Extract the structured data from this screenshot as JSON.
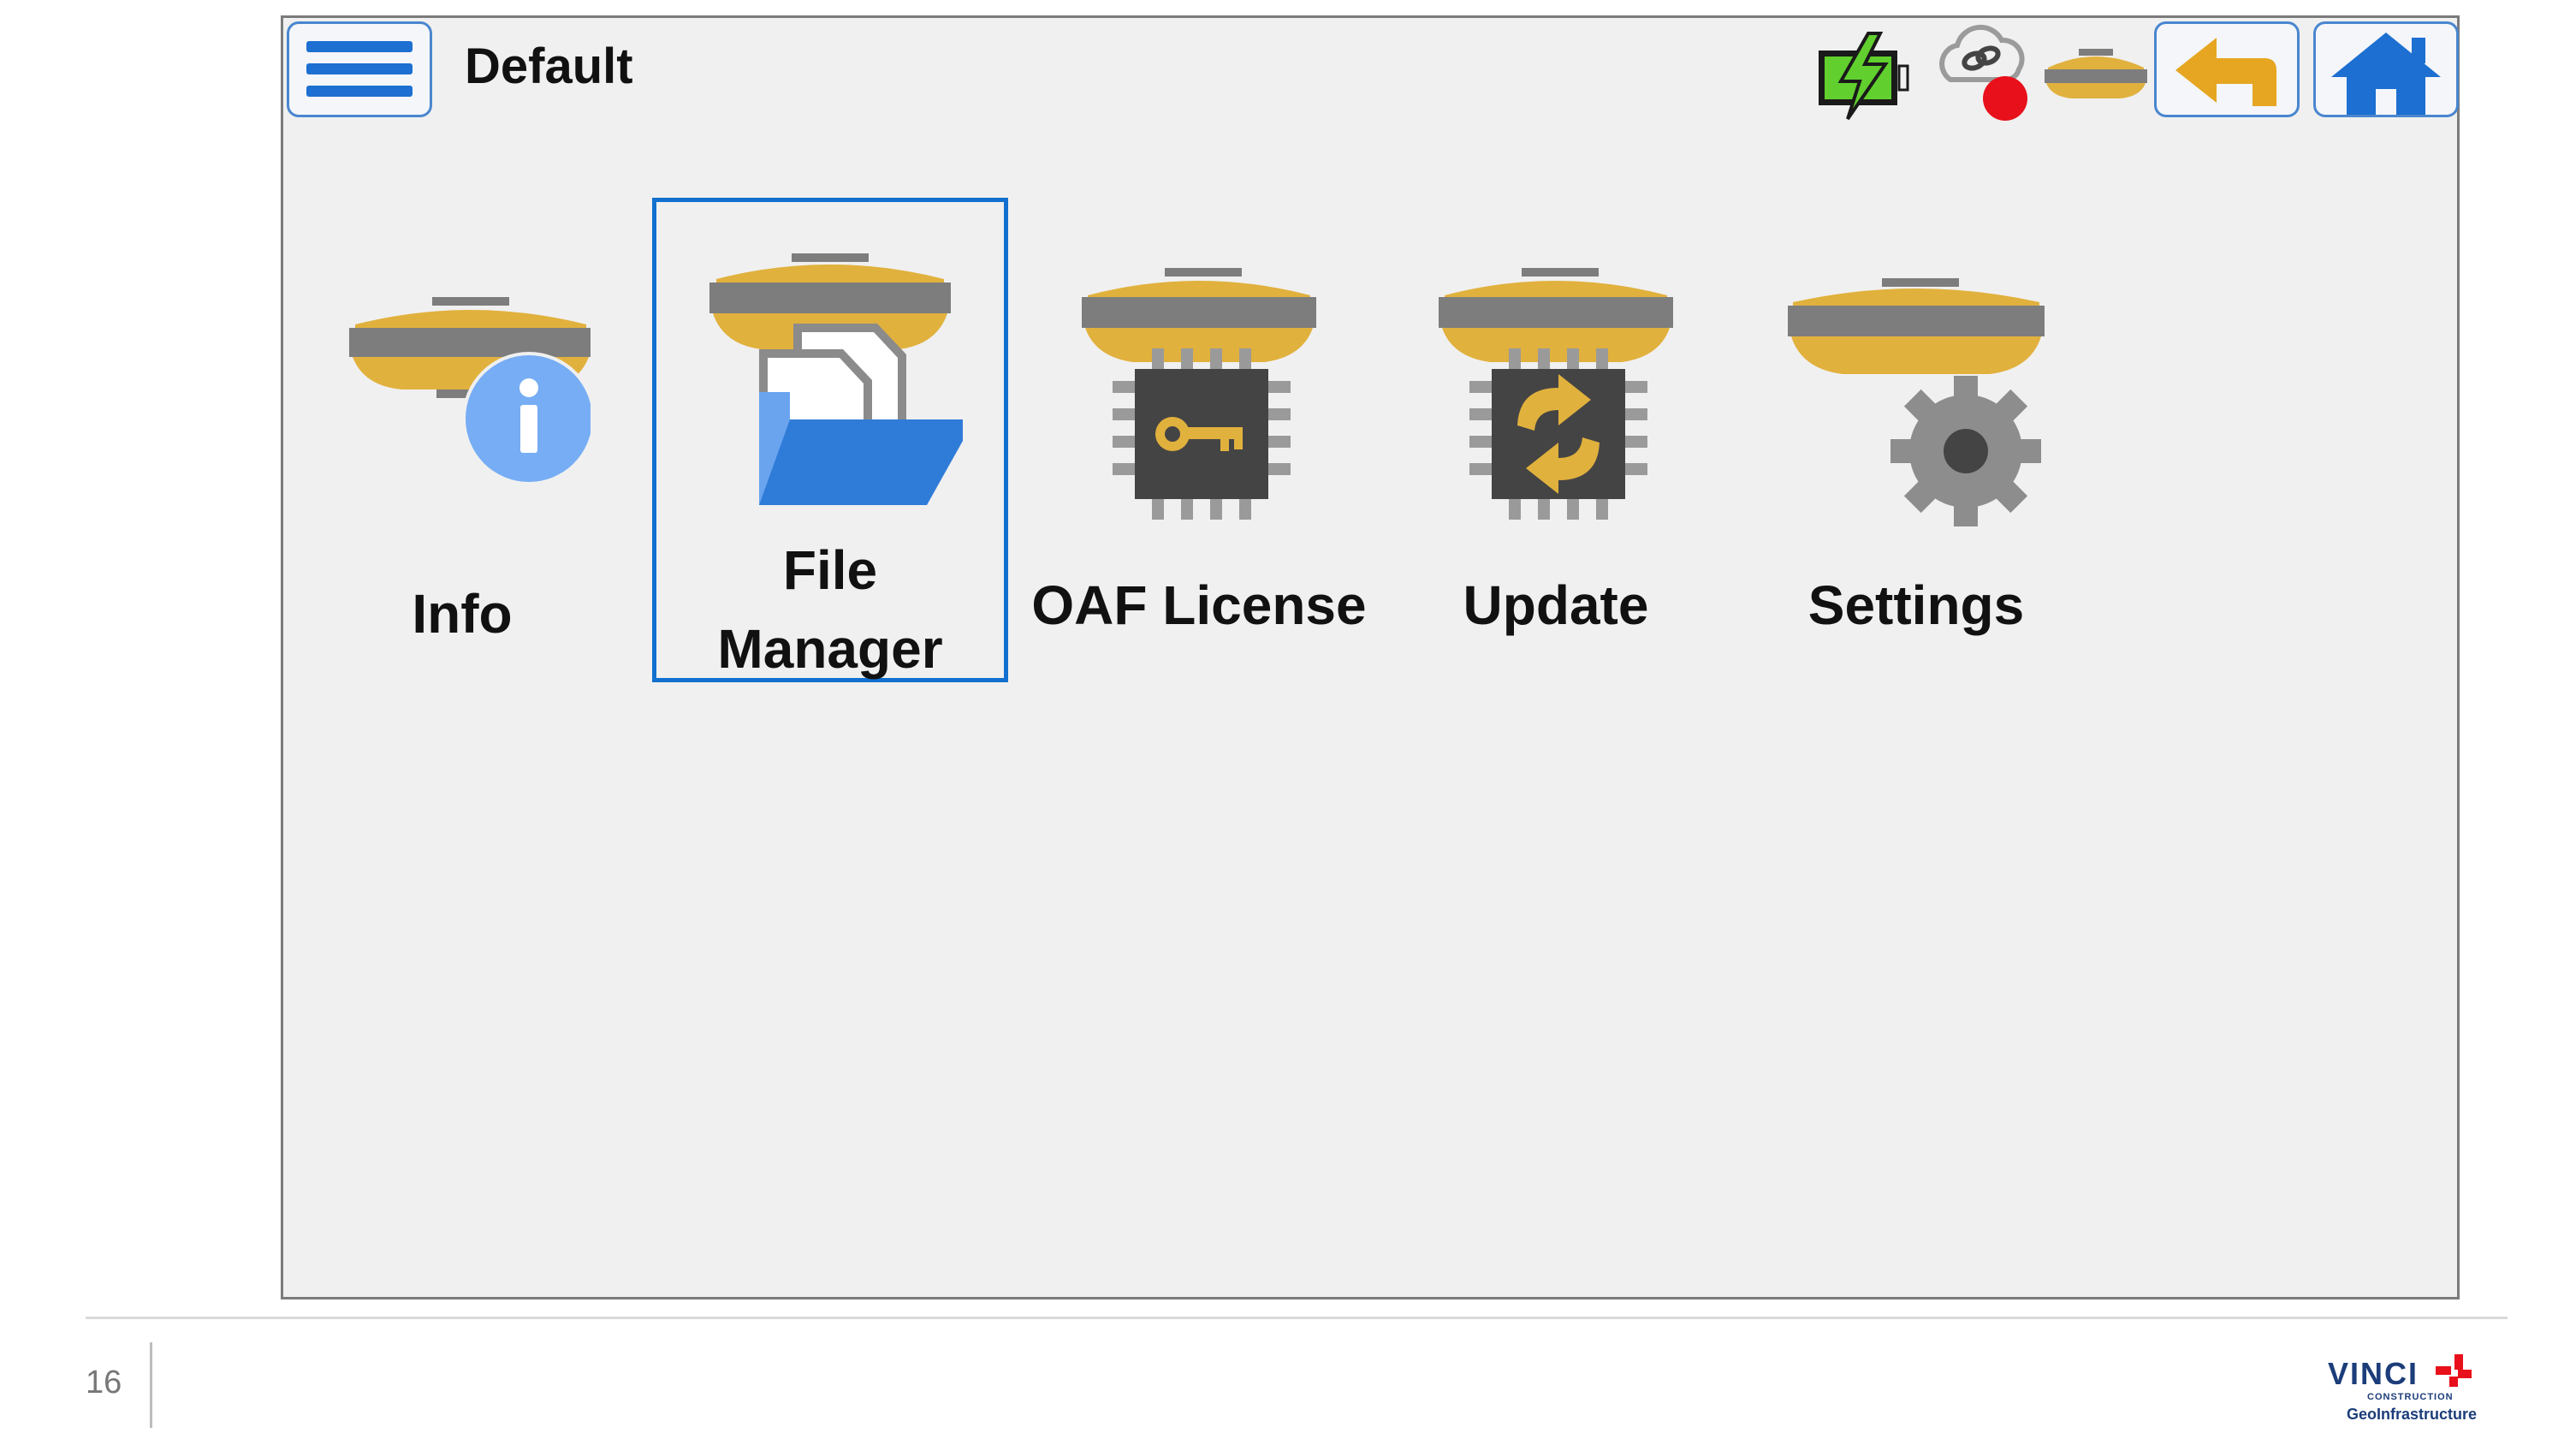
{
  "header": {
    "title": "Default",
    "menu_icon": "hamburger-menu-icon",
    "status_icons": [
      "battery-charging-icon",
      "cloud-link-disconnected-icon",
      "receiver-icon"
    ],
    "back_icon": "back-arrow-icon",
    "home_icon": "home-icon"
  },
  "tiles": [
    {
      "label": "Info",
      "icon": "receiver-info-icon"
    },
    {
      "label": "File\nManager",
      "icon": "receiver-file-manager-icon",
      "selected": true
    },
    {
      "label": "OAF License",
      "icon": "license-chip-key-icon"
    },
    {
      "label": "Update",
      "icon": "firmware-update-chip-icon"
    },
    {
      "label": "Settings",
      "icon": "receiver-settings-gear-icon"
    }
  ],
  "footer": {
    "page_number": "16",
    "logo_text": "VINCI",
    "logo_sub1": "CONSTRUCTION",
    "logo_sub2": "GeoInfrastructure"
  },
  "colors": {
    "accent": "#1170d0",
    "receiver_yellow": "#e1b13d",
    "receiver_band": "#7d7d7d",
    "status_red": "#e8101a",
    "battery_green": "#61d02e"
  }
}
